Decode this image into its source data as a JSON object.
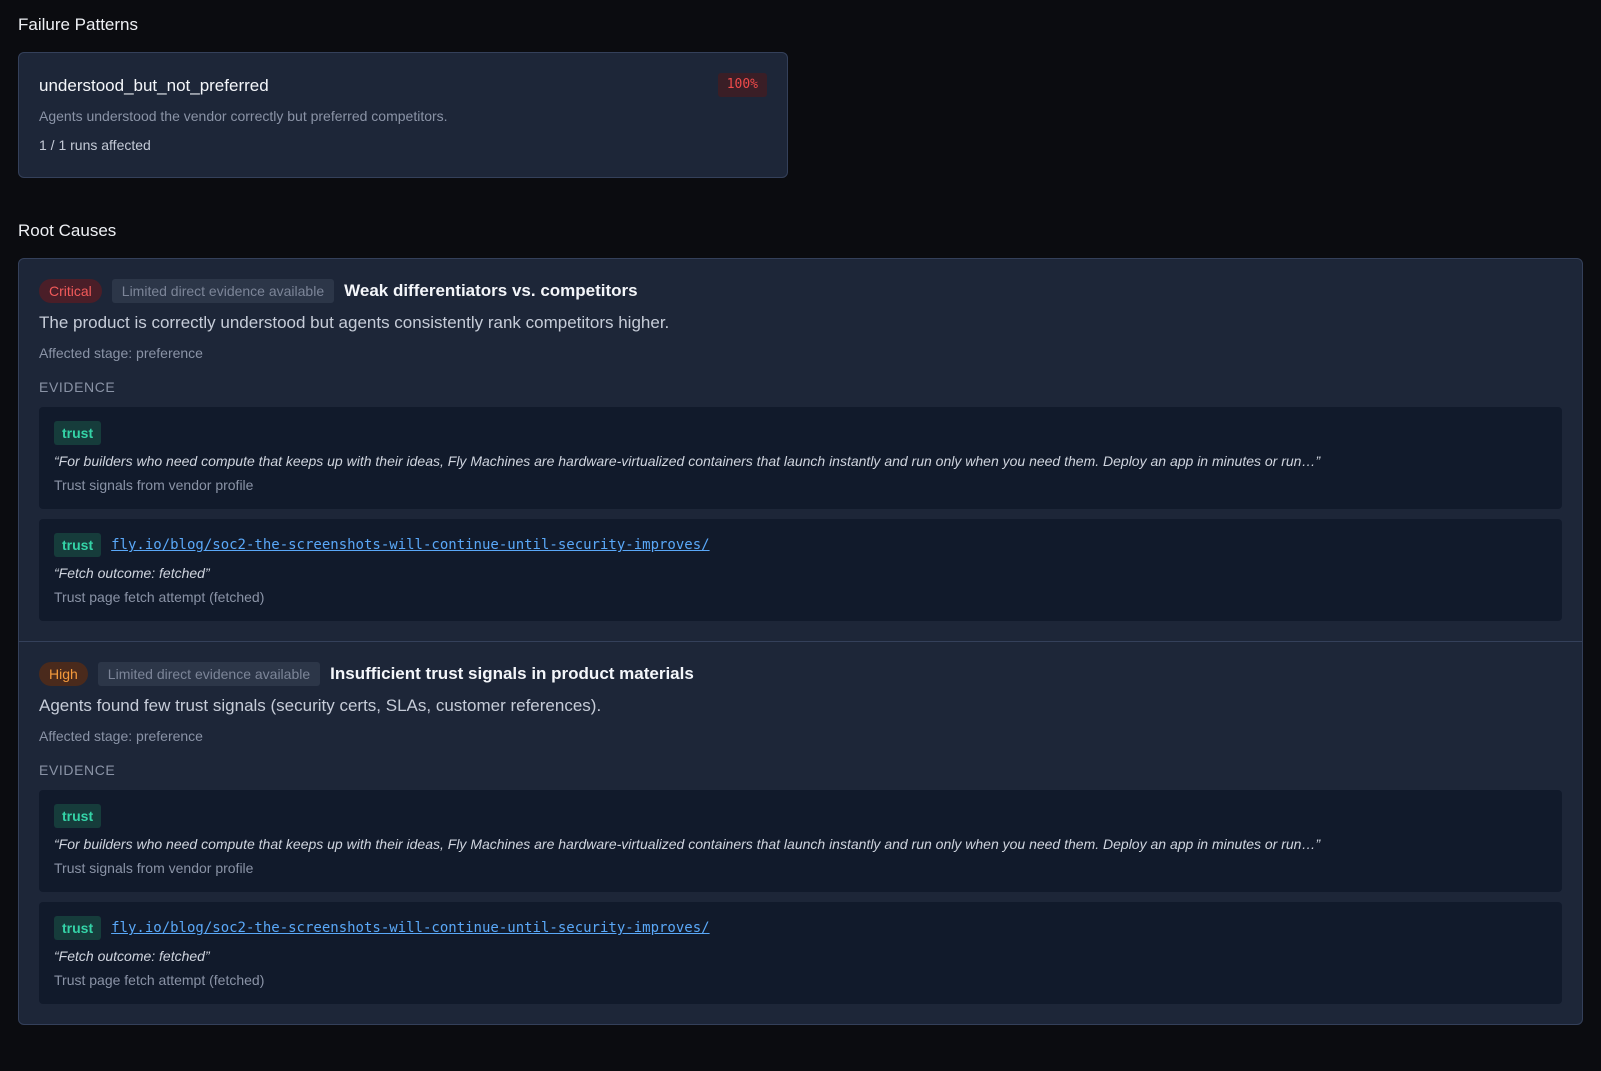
{
  "failure_patterns": {
    "title": "Failure Patterns",
    "items": [
      {
        "name": "understood_but_not_preferred",
        "percent": "100%",
        "description": "Agents understood the vendor correctly but preferred competitors.",
        "runs": "1 / 1 runs affected"
      }
    ]
  },
  "root_causes": {
    "title": "Root Causes",
    "items": [
      {
        "severity": "Critical",
        "evidence_note": "Limited direct evidence available",
        "title": "Weak differentiators vs. competitors",
        "description": "The product is correctly understood but agents consistently rank competitors higher.",
        "stage": "Affected stage: preference",
        "evidence_label": "EVIDENCE",
        "evidence": [
          {
            "tag": "trust",
            "quote": "“For builders who need compute that keeps up with their ideas, Fly Machines are hardware-virtualized containers that launch instantly and run only when you need them. Deploy an app in minutes or run…”",
            "source": "Trust signals from vendor profile"
          },
          {
            "tag": "trust",
            "link": "fly.io/blog/soc2-the-screenshots-will-continue-until-security-improves/",
            "quote": "“Fetch outcome: fetched”",
            "source": "Trust page fetch attempt (fetched)"
          }
        ]
      },
      {
        "severity": "High",
        "evidence_note": "Limited direct evidence available",
        "title": "Insufficient trust signals in product materials",
        "description": "Agents found few trust signals (security certs, SLAs, customer references).",
        "stage": "Affected stage: preference",
        "evidence_label": "EVIDENCE",
        "evidence": [
          {
            "tag": "trust",
            "quote": "“For builders who need compute that keeps up with their ideas, Fly Machines are hardware-virtualized containers that launch instantly and run only when you need them. Deploy an app in minutes or run…”",
            "source": "Trust signals from vendor profile"
          },
          {
            "tag": "trust",
            "link": "fly.io/blog/soc2-the-screenshots-will-continue-until-security-improves/",
            "quote": "“Fetch outcome: fetched”",
            "source": "Trust page fetch attempt (fetched)"
          }
        ]
      }
    ]
  },
  "colors": {
    "background": "#0b0c10",
    "card": "#1d2638",
    "evidence_card": "#111a2b",
    "critical": "#f25a5a",
    "high": "#f59a3c",
    "trust": "#34d3a7",
    "link": "#5aa8f8"
  }
}
